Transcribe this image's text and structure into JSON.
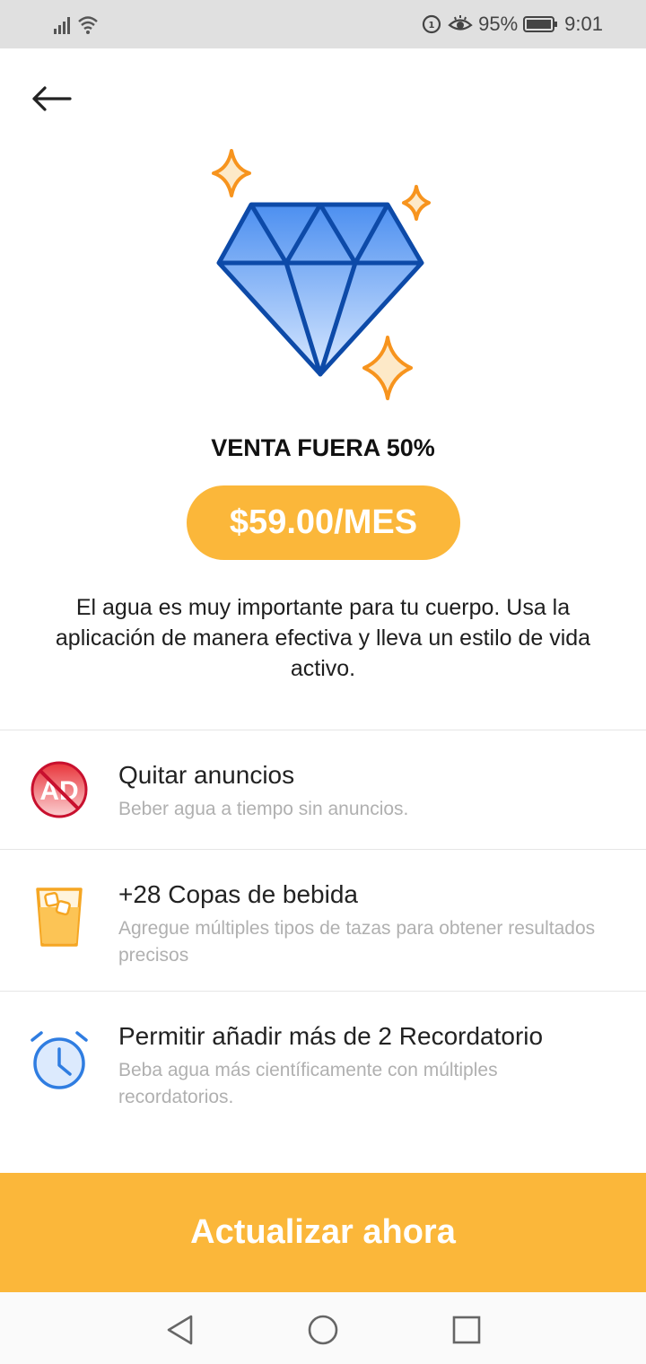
{
  "status_bar": {
    "battery": "95%",
    "time": "9:01",
    "icons": [
      "signal-icon",
      "wifi-icon",
      "data-saver-icon",
      "eye-comfort-icon",
      "battery-icon"
    ]
  },
  "header": {
    "back_icon": "arrow-left-icon"
  },
  "hero": {
    "icon": "diamond-icon",
    "colors": {
      "diamond": "#5a97f0",
      "outline": "#0d4aa8",
      "sparkle": "#f7941e"
    }
  },
  "offer": {
    "sale_label": "VENTA FUERA 50%",
    "price_label": "$59.00/MES"
  },
  "description": "El agua es muy importante para tu cuerpo. Usa la aplicación de manera efectiva y lleva un estilo de vida activo.",
  "features": [
    {
      "icon": "no-ads-icon",
      "title": "Quitar anuncios",
      "desc": "Beber agua a tiempo sin anuncios."
    },
    {
      "icon": "drink-cup-icon",
      "title": "+28 Copas de bebida",
      "desc": "Agregue múltiples tipos de tazas para obtener resultados precisos"
    },
    {
      "icon": "alarm-clock-icon",
      "title": "Permitir añadir más de 2 Recordatorio",
      "desc": "Beba agua más científicamente con múltiples recordatorios."
    }
  ],
  "cta_label": "Actualizar ahora",
  "nav_bar": {
    "icons": [
      "nav-back-icon",
      "nav-home-icon",
      "nav-recents-icon"
    ]
  },
  "colors": {
    "accent": "#fbb73a",
    "muted_text": "#b0b0b0",
    "status_bar_bg": "#e0e0e0"
  }
}
